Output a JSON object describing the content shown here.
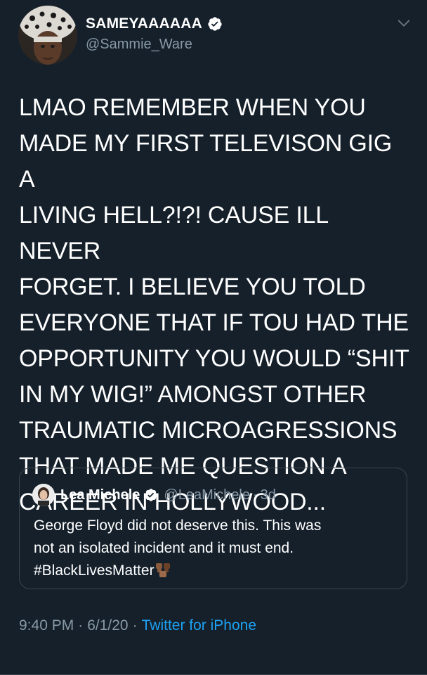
{
  "author": {
    "display_name": "SAMEYAAAAAA",
    "handle": "@Sammie_Ware"
  },
  "tweet": {
    "text": "LMAO REMEMBER WHEN YOU\nMADE MY FIRST TELEVISON GIG A\nLIVING HELL?!?! CAUSE ILL NEVER\nFORGET. I BELIEVE YOU TOLD\nEVERYONE THAT IF TOU HAD THE\nOPPORTUNITY YOU WOULD “SHIT\nIN MY WIG!” AMONGST OTHER\nTRAUMATIC MICROAGRESSIONS\nTHAT MADE ME QUESTION A\nCAREER IN HOLLYWOOD..."
  },
  "quoted": {
    "display_name": "Lea Michele",
    "handle": "@LeaMichele",
    "dot": "·",
    "age": "3d",
    "text": "George Floyd did not deserve this. This was\nnot an isolated incident and it must end.\n#BlackLivesMatter"
  },
  "meta": {
    "time": "9:40 PM",
    "sep1": "·",
    "date": "6/1/20",
    "sep2": "·",
    "source": "Twitter for iPhone"
  },
  "colors": {
    "background": "#15202b",
    "secondary_text": "#8899a6",
    "link": "#1da1f2",
    "verified": "#ffffff",
    "border": "#38444d"
  },
  "icons": {
    "verified": "verified-badge-icon",
    "caret": "chevron-down-icon",
    "emoji": "raised-fists-emoji"
  }
}
